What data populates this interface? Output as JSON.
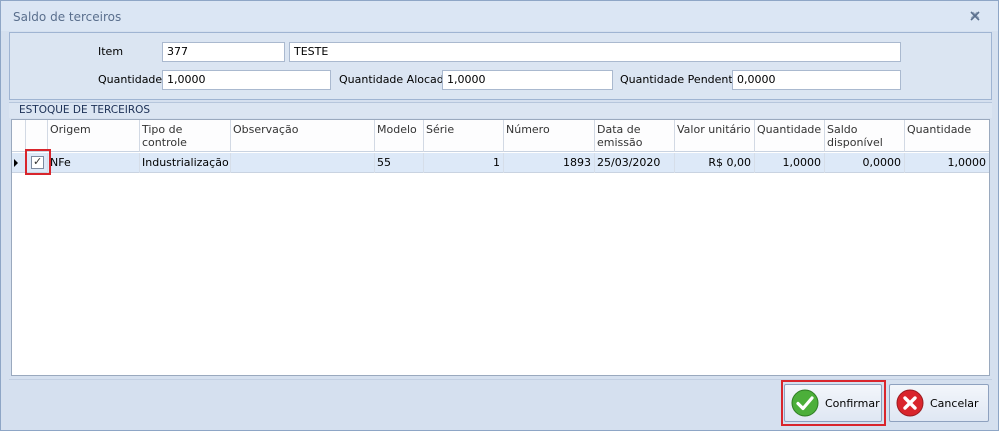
{
  "window": {
    "title": "Saldo de terceiros"
  },
  "form": {
    "item_label": "Item",
    "item_code": "377",
    "item_description": "TESTE",
    "quantidade_label": "Quantidade",
    "quantidade_value": "1,0000",
    "quantidade_alocada_label": "Quantidade Alocada",
    "quantidade_alocada_value": "1,0000",
    "quantidade_pendente_label": "Quantidade Pendente",
    "quantidade_pendente_value": "0,0000"
  },
  "group": {
    "title": "ESTOQUE DE TERCEIROS"
  },
  "grid": {
    "columns": [
      "Origem",
      "Tipo de controle",
      "Observação",
      "Modelo",
      "Série",
      "Número",
      "Data de emissão",
      "Valor unitário",
      "Quantidade",
      "Saldo disponível",
      "Quantidade"
    ],
    "rows": [
      {
        "checked": true,
        "origem": "NFe",
        "tipo_controle": "Industrialização",
        "observacao": "",
        "modelo": "55",
        "serie": "1",
        "numero": "1893",
        "data_emissao": "25/03/2020",
        "valor_unitario": "R$ 0,00",
        "quantidade": "1,0000",
        "saldo_disponivel": "0,0000",
        "quantidade2": "1,0000"
      }
    ]
  },
  "buttons": {
    "confirm_label": "Confirmar",
    "cancel_label": "Cancelar"
  },
  "colors": {
    "highlight_box": "#d9252c",
    "confirm_icon": "#4caf3a",
    "cancel_icon": "#d9252c"
  }
}
